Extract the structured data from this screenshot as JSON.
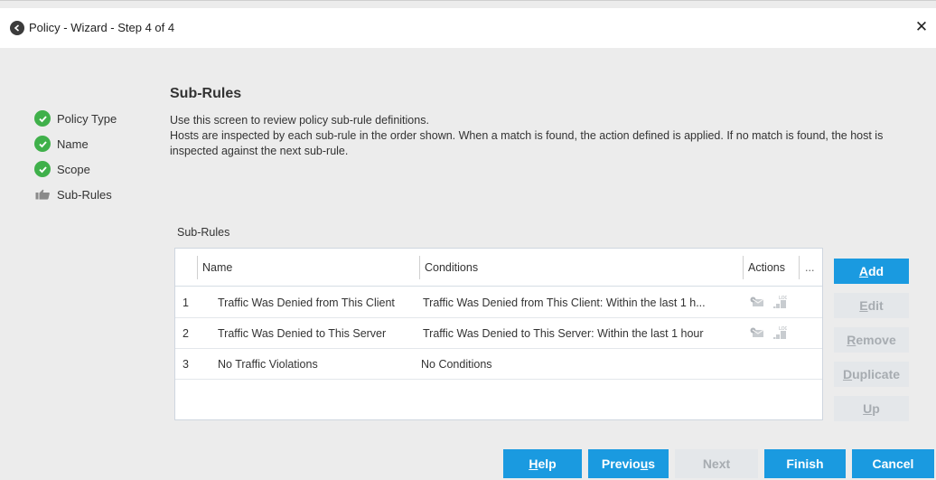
{
  "window": {
    "title": "Policy - Wizard - Step 4 of 4",
    "close_glyph": "✕"
  },
  "steps": [
    {
      "label": "Policy Type",
      "status": "complete",
      "icon": "check-circle-icon"
    },
    {
      "label": "Name",
      "status": "complete",
      "icon": "check-circle-icon"
    },
    {
      "label": "Scope",
      "status": "complete",
      "icon": "check-circle-icon"
    },
    {
      "label": "Sub-Rules",
      "status": "current",
      "icon": "thumbs-up-hand-icon"
    }
  ],
  "content": {
    "heading": "Sub-Rules",
    "description_line1": "Use this screen to review policy sub-rule definitions.",
    "description_line2": "Hosts are inspected by each sub-rule in the order shown. When a match is found, the action defined is applied. If no match is found, the host is inspected against the next sub-rule.",
    "table_caption": "Sub-Rules"
  },
  "table": {
    "columns": [
      "Name",
      "Conditions",
      "Actions",
      "..."
    ],
    "rows": [
      {
        "index": "1",
        "name": "Traffic Was Denied from This Client",
        "conditions": "Traffic Was Denied from This Client: Within the last 1 h...",
        "has_actions": true
      },
      {
        "index": "2",
        "name": "Traffic Was Denied to This Server",
        "conditions": "Traffic Was Denied to This Server: Within the last 1 hour",
        "has_actions": true
      },
      {
        "index": "3",
        "name": "No Traffic Violations",
        "conditions": "No Conditions",
        "has_actions": false
      }
    ]
  },
  "side_buttons": [
    {
      "pre": "",
      "key": "A",
      "post": "dd",
      "state": "primary"
    },
    {
      "pre": "",
      "key": "E",
      "post": "dit",
      "state": "disabled"
    },
    {
      "pre": "",
      "key": "R",
      "post": "emove",
      "state": "disabled"
    },
    {
      "pre": "",
      "key": "D",
      "post": "uplicate",
      "state": "disabled"
    },
    {
      "pre": "",
      "key": "U",
      "post": "p",
      "state": "disabled"
    }
  ],
  "bottom_buttons": [
    {
      "pre": "",
      "key": "H",
      "post": "elp",
      "state": "primary"
    },
    {
      "pre": "Previo",
      "key": "u",
      "post": "s",
      "state": "primary"
    },
    {
      "pre": "Next",
      "key": "",
      "post": "",
      "state": "disabled"
    },
    {
      "pre": "Finish",
      "key": "",
      "post": "",
      "state": "primary"
    },
    {
      "pre": "Cancel",
      "key": "",
      "post": "",
      "state": "primary"
    }
  ],
  "colors": {
    "accent": "#1a9ae0",
    "check": "#3fb04a",
    "disabled_bg": "#e4e7ea",
    "disabled_text": "#a7acb1"
  }
}
